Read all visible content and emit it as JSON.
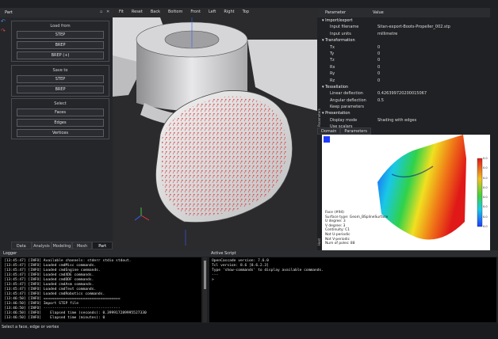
{
  "left_panel": {
    "title": "Part",
    "toolbar_icons": [
      "undo-icon",
      "redo-icon"
    ],
    "load_from": {
      "title": "Load from",
      "buttons": [
        "STEP",
        "BREP",
        "BREP (+)"
      ]
    },
    "save_to": {
      "title": "Save to",
      "buttons": [
        "STEP",
        "BREP"
      ]
    },
    "select": {
      "title": "Select",
      "buttons": [
        "Faces",
        "Edges",
        "Vertices"
      ]
    },
    "tabs": [
      "Data",
      "Analysis",
      "Modeling",
      "Mesh",
      "Part"
    ],
    "active_tab": "Part"
  },
  "viewport": {
    "toolbar": [
      "Fit",
      "Reset",
      "Back",
      "Bottom",
      "Front",
      "Left",
      "Right",
      "Top"
    ]
  },
  "parameters": {
    "header": {
      "name": "Parameter",
      "value": "Value"
    },
    "rows": [
      {
        "name": "Import/export",
        "value": "",
        "section": true
      },
      {
        "name": "Input filename",
        "value": "Sitan-export-Boots-Propeller_002.stp",
        "section": false
      },
      {
        "name": "Input units",
        "value": "millimetre",
        "section": false
      },
      {
        "name": "Transformation",
        "value": "",
        "section": true
      },
      {
        "name": "Tx",
        "value": "0",
        "section": false
      },
      {
        "name": "Ty",
        "value": "0",
        "section": false
      },
      {
        "name": "Tz",
        "value": "0",
        "section": false
      },
      {
        "name": "Rx",
        "value": "0",
        "section": false
      },
      {
        "name": "Ry",
        "value": "0",
        "section": false
      },
      {
        "name": "Rz",
        "value": "0",
        "section": false
      },
      {
        "name": "Tessellation",
        "value": "",
        "section": true
      },
      {
        "name": "Linear deflection",
        "value": "0.426399720200015067",
        "section": false
      },
      {
        "name": "Angular deflection",
        "value": "0.5",
        "section": false
      },
      {
        "name": "Keep parameters",
        "value": "",
        "section": false
      },
      {
        "name": "Presentation",
        "value": "",
        "section": true
      },
      {
        "name": "Display mode",
        "value": "Shading with edges",
        "section": false
      },
      {
        "name": "Use scalars",
        "value": "",
        "section": false
      }
    ],
    "tabs": [
      "Domain",
      "Parameters"
    ],
    "side_labels": [
      "Parameters",
      "Host"
    ]
  },
  "face_info": {
    "lines": [
      "Face (#94)",
      "Surface type: Geom_BSplineSurface",
      "U degree: 3",
      "V degree: 3",
      "Continuity: C1",
      "Not U-periodic",
      "Not V-periodic",
      "Num of poles: 88"
    ],
    "colorbar_ticks": [
      "0.0",
      "0.0",
      "0.0",
      "0.0",
      "0.0",
      "0.0",
      "0.0",
      "0.0"
    ]
  },
  "logger": {
    "title": "Logger",
    "lines": [
      "[13:45:47] [INFO] Available channels: stderr stdio stdout.",
      "[13:45:47] [INFO] Loaded cmdMisc commands.",
      "[13:45:47] [INFO] Loaded cmdEngine commands.",
      "[13:45:47] [INFO] Loaded cmdXDE commands.",
      "[13:45:47] [INFO] Loaded cmdDDF commands.",
      "[13:45:47] [INFO] Loaded cmdAsm commands.",
      "[13:45:47] [INFO] Loaded cmdText commands.",
      "[13:45:47] [INFO] Loaded cmdRobotics commands.",
      "[13:46:50] [INFO] ===================================",
      "[13:46:50] [INFO] Import STEP file",
      "[13:46:50] [INFO] -----------------------------------",
      "[13:46:50] [INFO]    Elapsed time (seconds): 0.399917289995527330",
      "[13:46:50] [INFO]    Elapsed time (minutes): 0"
    ]
  },
  "script": {
    "title": "Active Script",
    "lines": [
      "OpenCascade version: 7.6.0",
      "Tcl version: 8.6 [8.6.2.3]",
      "Type 'show-commands' to display available commands.",
      "---",
      ">"
    ]
  },
  "status_bar": {
    "text": "Select a face, edge or vertex"
  },
  "colors": {
    "panel": "#24262a",
    "viewport": "#2b2b2d",
    "accent_red": "#e03a3a"
  }
}
